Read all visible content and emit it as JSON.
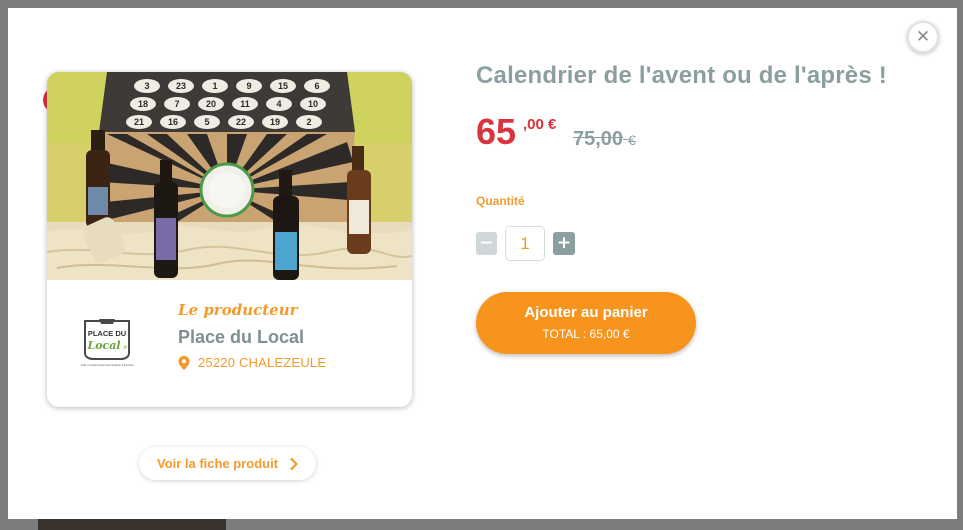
{
  "colors": {
    "accent_orange": "#f39a2b",
    "button_orange": "#f7941d",
    "price_red": "#d9333f",
    "title_gray": "#8b9ea0",
    "overlay": "#7d7d7d"
  },
  "modal": {
    "close_icon": "close-icon"
  },
  "product": {
    "title": "Calendrier de l'avent ou de l'après !",
    "price_int": "65",
    "price_dec": ",00 €",
    "old_price": "75,00",
    "old_price_currency": "€",
    "image_alt": "Calendrier de l'avent bière box with bottles"
  },
  "producer": {
    "kicker": "Le producteur",
    "name": "Place du Local",
    "location": "25220 CHALEZEULE",
    "logo_line1": "PLACE DU",
    "logo_line2": "Local",
    "logo_line2_suffix": ".fr",
    "logo_tagline": "Votre e-marché local avec livraison à domicile",
    "pin_icon": "map-pin-icon"
  },
  "quantity": {
    "label": "Quantité",
    "value": "1",
    "minus_icon": "minus-icon",
    "plus_icon": "plus-icon"
  },
  "cart": {
    "button_label": "Ajouter au panier",
    "total": "TOTAL : 65,00 €"
  },
  "product_link": {
    "label": "Voir la fiche produit",
    "icon": "chevron-right-icon"
  },
  "calendar_numbers": [
    [
      "3",
      "23",
      "1",
      "9",
      "15",
      "6"
    ],
    [
      "18",
      "7",
      "20",
      "11",
      "4",
      "10"
    ],
    [
      "21",
      "16",
      "5",
      "22",
      "19",
      "2"
    ]
  ]
}
